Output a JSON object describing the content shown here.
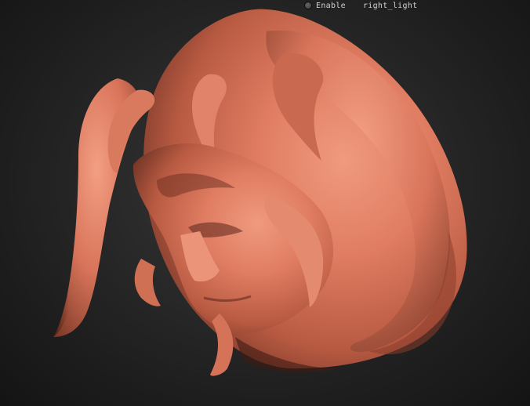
{
  "light_panel": {
    "enable_label": "Enable",
    "enabled": false,
    "light_name": "right_light"
  },
  "viewport": {
    "background_color": "#2a2a2a",
    "model_color": "#d9735a",
    "model_icon": "demon-head-sculpt"
  }
}
